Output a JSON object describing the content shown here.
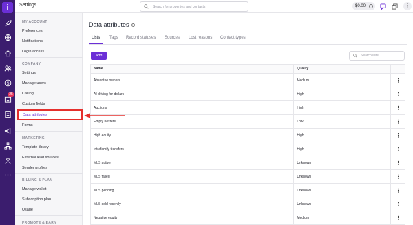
{
  "topbar": {
    "title": "Settings",
    "search_placeholder": "Search for properties and contacts",
    "wallet": "$0.00",
    "more": "⋮"
  },
  "rail": {
    "logo": "i",
    "badge": "25",
    "icons": [
      "rocket-icon",
      "globe-icon",
      "home-icon",
      "contacts-icon",
      "dollar-icon",
      "inbox-icon",
      "list-icon",
      "megaphone-icon",
      "org-chart-icon",
      "people-icon",
      "dots-icon"
    ]
  },
  "sidebar": {
    "sections": [
      "MY ACCOUNT",
      "COMPANY",
      "MARKETING",
      "BILLING & PLAN",
      "PROMOTE & EARN"
    ],
    "items": {
      "preferences": "Preferences",
      "notifications": "Notifications",
      "login_access": "Login access",
      "settings": "Settings",
      "manage_users": "Manage users",
      "calling": "Calling",
      "custom_fields": "Custom fields",
      "data_attributes": "Data attributes",
      "forms": "Forms",
      "template_library": "Template library",
      "external_lead_sources": "External lead sources",
      "sender_profiles": "Sender profiles",
      "manage_wallet": "Manage wallet",
      "subscription_plan": "Subscription plan",
      "usage": "Usage"
    }
  },
  "main": {
    "title": "Data attributes",
    "tabs": [
      "Lists",
      "Tags",
      "Record statuses",
      "Sources",
      "Lost reasons",
      "Contact types"
    ],
    "add_label": "Add",
    "search_placeholder": "Search lists",
    "table": {
      "headers": [
        "Name",
        "Quality",
        ""
      ],
      "rows": [
        {
          "name": "Absentee owners",
          "quality": "Medium"
        },
        {
          "name": "AI driving for dollars",
          "quality": "High"
        },
        {
          "name": "Auctions",
          "quality": "High"
        },
        {
          "name": "Empty nesters",
          "quality": "Low"
        },
        {
          "name": "High equity",
          "quality": "High"
        },
        {
          "name": "Intrafamily transfers",
          "quality": "High"
        },
        {
          "name": "MLS active",
          "quality": "Unknown"
        },
        {
          "name": "MLS failed",
          "quality": "Unknown"
        },
        {
          "name": "MLS pending",
          "quality": "Unknown"
        },
        {
          "name": "MLS sold recently",
          "quality": "Unknown"
        },
        {
          "name": "Negative equity",
          "quality": "Medium"
        }
      ]
    }
  },
  "colors": {
    "accent": "#6b2fd6",
    "rail": "#3b1d6e",
    "annotation": "#e5302d"
  }
}
